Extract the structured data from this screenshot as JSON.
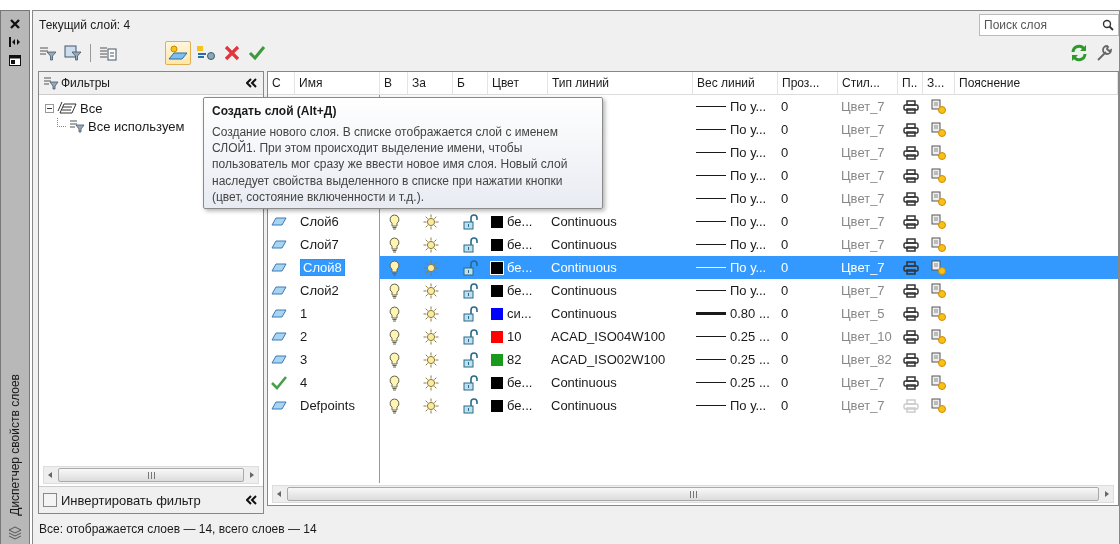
{
  "side_panel": {
    "title": "Диспетчер свойств слоев"
  },
  "current_layer": "Текущий слой: 4",
  "search": {
    "placeholder": "Поиск слоя"
  },
  "filters": {
    "title": "Фильтры",
    "tree": [
      {
        "label": "Все",
        "expanded": true,
        "children": [
          {
            "label": "Все используем"
          }
        ]
      }
    ],
    "invert": {
      "label": "Инвертировать фильтр",
      "checked": false
    }
  },
  "table": {
    "columns": [
      "С",
      "Имя",
      "В",
      "За",
      "Б",
      "Цвет",
      "Тип линий",
      "Вес линий",
      "Проз...",
      "Стил...",
      "П..",
      "З...",
      "Пояснение"
    ],
    "rows": [
      {
        "lineweight": "По у...",
        "transparency": "0",
        "plot_style": "Цвет_7",
        "plot": true,
        "selected": false
      },
      {
        "lineweight": "По у...",
        "transparency": "0",
        "plot_style": "Цвет_7",
        "plot": true,
        "selected": false
      },
      {
        "lineweight": "По у...",
        "transparency": "0",
        "plot_style": "Цвет_7",
        "plot": true,
        "selected": false
      },
      {
        "lineweight": "По у...",
        "transparency": "0",
        "plot_style": "Цвет_7",
        "plot": true,
        "selected": false
      },
      {
        "lineweight": "По у...",
        "transparency": "0",
        "plot_style": "Цвет_7",
        "plot": true,
        "selected": false
      },
      {
        "kind": "layer",
        "name": "Слой6",
        "on": true,
        "frozen": false,
        "locked": false,
        "color": "#000000",
        "color_name": "бе...",
        "linetype": "Continuous",
        "lineweight": "По у...",
        "heavy": false,
        "transparency": "0",
        "plot_style": "Цвет_7",
        "plot": true,
        "selected": false
      },
      {
        "kind": "layer",
        "name": "Слой7",
        "on": true,
        "frozen": false,
        "locked": false,
        "color": "#000000",
        "color_name": "бе...",
        "linetype": "Continuous",
        "lineweight": "По у...",
        "heavy": false,
        "transparency": "0",
        "plot_style": "Цвет_7",
        "plot": true,
        "selected": false
      },
      {
        "kind": "layer",
        "name": "Слой8",
        "on": true,
        "frozen": false,
        "locked": false,
        "color": "#000000",
        "color_name": "бе...",
        "linetype": "Continuous",
        "lineweight": "По у...",
        "heavy": false,
        "transparency": "0",
        "plot_style": "Цвет_7",
        "plot": true,
        "selected": true
      },
      {
        "kind": "layer",
        "name": "Слой2",
        "on": true,
        "frozen": false,
        "locked": false,
        "color": "#000000",
        "color_name": "бе...",
        "linetype": "Continuous",
        "lineweight": "По у...",
        "heavy": false,
        "transparency": "0",
        "plot_style": "Цвет_7",
        "plot": true,
        "selected": false
      },
      {
        "kind": "layer",
        "name": "1",
        "on": true,
        "frozen": false,
        "locked": false,
        "color": "#0000ff",
        "color_name": "си...",
        "linetype": "Continuous",
        "lineweight": "0.80 ...",
        "heavy": true,
        "transparency": "0",
        "plot_style": "Цвет_5",
        "plot": true,
        "selected": false
      },
      {
        "kind": "layer",
        "name": "2",
        "on": true,
        "frozen": false,
        "locked": false,
        "color": "#ff0000",
        "color_name": "10",
        "linetype": "ACAD_ISO04W100",
        "lineweight": "0.25 ...",
        "heavy": false,
        "transparency": "0",
        "plot_style": "Цвет_10",
        "plot": true,
        "selected": false
      },
      {
        "kind": "layer",
        "name": "3",
        "on": true,
        "frozen": false,
        "locked": false,
        "color": "#1a9a1a",
        "color_name": "82",
        "linetype": "ACAD_ISO02W100",
        "lineweight": "0.25 ...",
        "heavy": false,
        "transparency": "0",
        "plot_style": "Цвет_82",
        "plot": true,
        "selected": false
      },
      {
        "kind": "current",
        "name": "4",
        "on": true,
        "frozen": false,
        "locked": false,
        "color": "#000000",
        "color_name": "бе...",
        "linetype": "Continuous",
        "lineweight": "0.25 ...",
        "heavy": false,
        "transparency": "0",
        "plot_style": "Цвет_7",
        "plot": true,
        "selected": false
      },
      {
        "kind": "layer",
        "name": "Defpoints",
        "on": true,
        "frozen": false,
        "locked": false,
        "color": "#000000",
        "color_name": "бе...",
        "linetype": "Continuous",
        "lineweight": "По у...",
        "heavy": false,
        "transparency": "0",
        "plot_style": "Цвет_7",
        "plot": false,
        "selected": false
      }
    ]
  },
  "tooltip": {
    "title": "Создать слой (Alt+Д)",
    "text": "Создание нового слоя. В списке отображается слой с именем СЛОЙ1. При этом происходит выделение имени, чтобы пользователь мог сразу же ввести новое имя слоя. Новый слой наследует свойства выделенного в списке при нажатии кнопки (цвет, состояние включенности и т.д.)."
  },
  "status_bar": "Все: отображается слоев — 14, всего слоев — 14"
}
